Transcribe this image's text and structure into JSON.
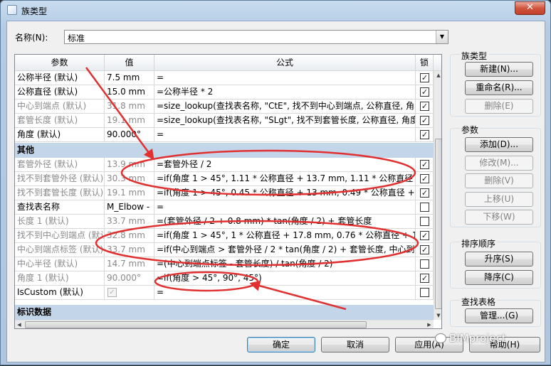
{
  "window": {
    "title": "族类型",
    "close_label": "✕"
  },
  "name_field": {
    "label": "名称(N):",
    "value": "标准",
    "arrow": "▼"
  },
  "grid": {
    "headers": {
      "param": "参数",
      "value": "值",
      "formula": "公式",
      "lock": "锁"
    },
    "rows": [
      {
        "param": "公称半径 (默认)",
        "value": "7.5 mm",
        "formula": "=",
        "checked": true,
        "grey": false
      },
      {
        "param": "公称直径 (默认)",
        "value": "15.0 mm",
        "formula": "=公称半径 * 2",
        "checked": true,
        "grey": false
      },
      {
        "param": "中心到端点 (默认)",
        "value": "31.8 mm",
        "formula": "=size_lookup(查找表名称, \"CtE\", 找不到中心到端点, 公称直径, 角",
        "checked": true,
        "grey": true
      },
      {
        "param": "套管长度 (默认)",
        "value": "19.1 mm",
        "formula": "=size_lookup(查找表名称, \"SLgt\", 找不到套管长度, 公称直径, 角度",
        "checked": true,
        "grey": true
      },
      {
        "param": "角度 (默认)",
        "value": "90.000°",
        "formula": "=",
        "checked": true,
        "grey": false
      }
    ],
    "group_other": "其他",
    "rows2": [
      {
        "param": "套管外径 (默认)",
        "value": "13.9 mm",
        "formula": "=套管外径 / 2",
        "checked": true,
        "grey": true
      },
      {
        "param": "找不到套管外径 (默认)",
        "value": "30.3 mm",
        "formula": "=if(角度 1 > 45°, 1.11 * 公称直径 + 13.7 mm, 1.11 * 公称直径 +",
        "checked": true,
        "grey": true
      },
      {
        "param": "找不到套管长度 (默认)",
        "value": "19.1 mm",
        "formula": "=if(角度 1 > 45°, 0.45 * 公称直径 + 13 mm, 0.49 * 公称直径 + 12",
        "checked": true,
        "grey": true
      },
      {
        "param": "查找表名称",
        "value": "M_Elbow -",
        "formula": "=",
        "checked": false,
        "grey": false
      },
      {
        "param": "长度 1 (默认)",
        "value": "33.7 mm",
        "formula": "=(套管外径 / 2 + 0.8 mm) * tan(角度 / 2) + 套管长度",
        "checked": false,
        "grey": true
      },
      {
        "param": "找不到中心到端点 (默认)",
        "value": "32.8 mm",
        "formula": "=if(角度 1 > 45°, 1 * 公称直径 + 17.8 mm, 0.76 * 公称直径 + 15.",
        "checked": true,
        "grey": true
      },
      {
        "param": "中心到端点标签 (默认)",
        "value": "33.7 mm",
        "formula": "=if(中心到端点 > 套管外径 / 2 * tan(角度 / 2) + 套管长度, 中心到",
        "checked": true,
        "grey": true
      },
      {
        "param": "中心半径 (默认)",
        "value": "14.7 mm",
        "formula": "=(中心到端点标签 - 套管长度) / tan(角度 / 2)",
        "checked": false,
        "grey": true
      },
      {
        "param": "角度 1 (默认)",
        "value": "90.000°",
        "formula": "=if(角度 > 45°, 90°, 45°)",
        "checked": true,
        "grey": true
      },
      {
        "param": "IsCustom (默认)",
        "value": "",
        "formula": "=",
        "checked": false,
        "grey": false
      }
    ],
    "group_id": "标识数据",
    "check_mark": "✓",
    "arrows": {
      "up": "▲",
      "down": "▼",
      "left": "◀",
      "right": "▶"
    }
  },
  "panels": {
    "family_types": {
      "title": "族类型",
      "new": "新建(N)...",
      "rename": "重命名(R)...",
      "delete": "删除(E)"
    },
    "parameters": {
      "title": "参数",
      "add": "添加(D)...",
      "modify": "修改(M)...",
      "delete": "删除(V)",
      "up": "上移(U)",
      "down": "下移(W)"
    },
    "sort": {
      "title": "排序顺序",
      "asc": "升序(S)",
      "desc": "降序(C)"
    },
    "lookup": {
      "title": "查找表格",
      "manage": "管理...(G)"
    }
  },
  "buttons": {
    "ok": "确定",
    "cancel": "取消",
    "apply": "应用(A)",
    "help": "帮助(H)"
  },
  "watermark": "BIMproject",
  "annotation_color": "#e03030"
}
